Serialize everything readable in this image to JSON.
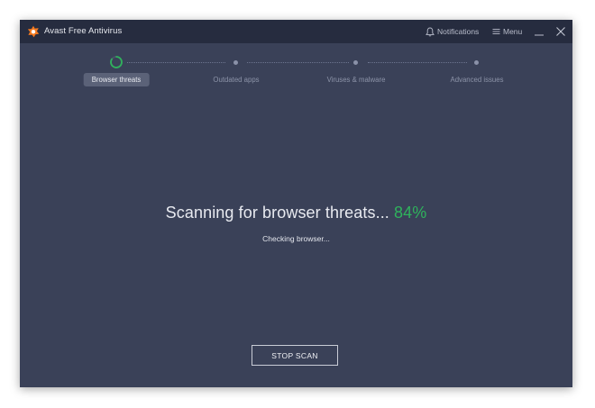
{
  "window": {
    "title": "Avast Free Antivirus",
    "notifications_label": "Notifications",
    "menu_label": "Menu"
  },
  "steps": [
    {
      "label": "Browser threats",
      "active": true,
      "progress": 0.84
    },
    {
      "label": "Outdated apps",
      "active": false
    },
    {
      "label": "Viruses & malware",
      "active": false
    },
    {
      "label": "Advanced issues",
      "active": false
    }
  ],
  "scan": {
    "title": "Scanning for browser threats...",
    "percent": "84%",
    "status": "Checking browser..."
  },
  "actions": {
    "stop_label": "STOP SCAN"
  },
  "colors": {
    "background": "#3a4158",
    "titlebar": "#262c3f",
    "accent_green": "#2fb25c",
    "brand_orange": "#f47a20"
  }
}
